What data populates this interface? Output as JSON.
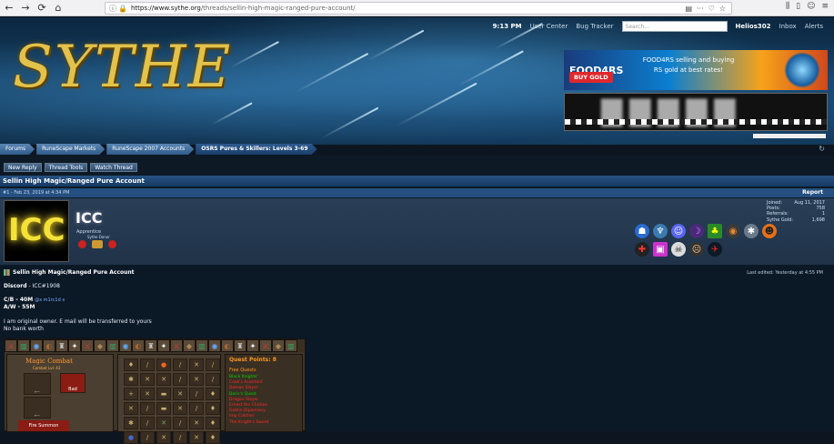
{
  "browser": {
    "url_host": "https://www.sythe.org",
    "url_path": "/threads/sellin-high-magic-ranged-pure-account/"
  },
  "header": {
    "logo_text": "SYTHE",
    "time": "9:13 PM",
    "nav": [
      "User Center",
      "Bug Tracker"
    ],
    "search_placeholder": "Search...",
    "username": "Helios302",
    "inbox": "Inbox",
    "alerts": "Alerts"
  },
  "ads": {
    "ad1_brand": "FOOD4RS",
    "ad1_text": "FOOD4RS selling and buying RS gold at best rates!",
    "ad1_button": "BUY GOLD"
  },
  "breadcrumb": [
    "Forums",
    "RuneScape Markets",
    "RuneScape 2007 Accounts",
    "OSRS Pures & Skillers: Levels 3-69"
  ],
  "toolbar": [
    "New Reply",
    "Thread Tools",
    "Watch Thread"
  ],
  "thread": {
    "title": "Sellin High Magic/Ranged Pure Account",
    "post_meta": "#1 - Feb 23, 2019 at 4:34 PM",
    "report": "Report"
  },
  "user": {
    "name": "ICC",
    "avatar_text": "ICC",
    "rank": "Apprentice",
    "rank2": "Sythe Donor",
    "stats": [
      {
        "label": "Joined:",
        "value": "Aug 11, 2017"
      },
      {
        "label": "Posts:",
        "value": "758"
      },
      {
        "label": "Referrals:",
        "value": "1"
      },
      {
        "label": "Sythe Gold:",
        "value": "1,698"
      }
    ]
  },
  "post": {
    "subject": "Sellin High Magic/Ranged Pure Account",
    "last_edited": "Last edited: Yesterday at 4:55 PM",
    "discord_label": "Discord",
    "discord_value": " - ICC#1908",
    "cb_label": "C/B",
    "cb_value": " - 40M",
    "cb_link": "@x m1rc1d x",
    "aw_label": "A/W",
    "aw_value": " - 55M",
    "line1": "I am original owner. E mail will be transferred to yours",
    "line2": "No bank worth"
  },
  "rs_panel": {
    "magic_title": "Magic Combat",
    "magic_sub": "Combat Lvl: 43",
    "red_label": "Bad",
    "red2_label": "Fire Summon",
    "quest_title": "Quest Points: 8",
    "quest_sub": "Free Quests",
    "quests": [
      {
        "name": "Black Knights'",
        "status": "done"
      },
      {
        "name": "Cook's Assistant",
        "status": "todo"
      },
      {
        "name": "Demon Slayer",
        "status": "todo"
      },
      {
        "name": "Doric's Quest",
        "status": "done"
      },
      {
        "name": "Dragon Slayer",
        "status": "todo"
      },
      {
        "name": "Ernest the Chicken",
        "status": "todo"
      },
      {
        "name": "Goblin Diplomacy",
        "status": "todo"
      },
      {
        "name": "Imp Catcher",
        "status": "todo"
      },
      {
        "name": "The Knight's Sword",
        "status": "todo"
      }
    ]
  },
  "colors": {
    "header_bg": "#143c5e",
    "logo_gold": "#e2c24a",
    "quest_done": "#00d800",
    "quest_todo": "#ff2a2a"
  }
}
